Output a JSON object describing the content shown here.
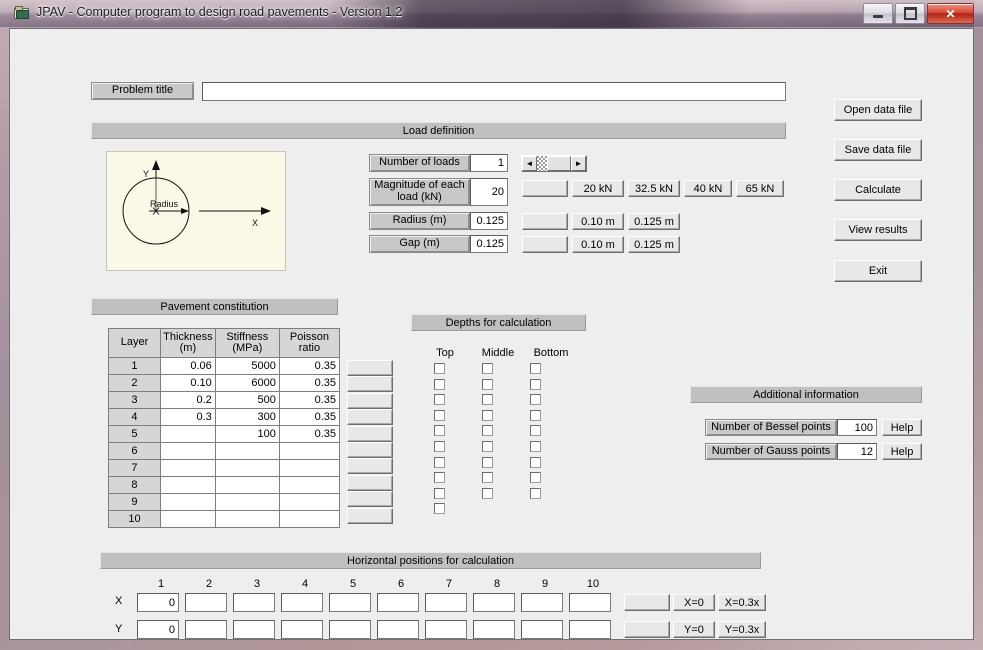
{
  "window": {
    "title": "JPAV - Computer program to design road pavements - Version 1.2",
    "icon": "folder-icon",
    "minimize_label": "—",
    "maximize_label": "□",
    "close_label": "✕"
  },
  "problem": {
    "label": "Problem title",
    "value": "",
    "placeholder": ""
  },
  "load_definition": {
    "section_title": "Load definition",
    "diagram": {
      "y_axis_label": "Y",
      "x_axis_label": "X",
      "radius_label": "Radius",
      "center_marker": "x",
      "bg_color": "#fbf8e8"
    },
    "fields": [
      {
        "label": "Number of loads",
        "value": "1"
      },
      {
        "label": "Magnitude of each load (kN)",
        "value": "20"
      },
      {
        "label": "Radius (m)",
        "value": "0.125"
      },
      {
        "label": "Gap (m)",
        "value": "0.125"
      }
    ],
    "spinner": {
      "left_arrow": "◄",
      "right_arrow": "►"
    },
    "magnitude_presets": [
      "",
      "20 kN",
      "32.5 kN",
      "40 kN",
      "65 kN"
    ],
    "radius_presets": [
      "",
      "0.10 m",
      "0.125 m"
    ],
    "gap_presets": [
      "",
      "0.10 m",
      "0.125 m"
    ]
  },
  "actions": {
    "open": "Open data file",
    "save": "Save data file",
    "calculate": "Calculate",
    "view_results": "View results",
    "exit": "Exit"
  },
  "pavement": {
    "section_title": "Pavement constitution",
    "columns": [
      "Layer",
      "Thickness (m)",
      "Stiffness (MPa)",
      "Poisson ratio"
    ],
    "column_lines": [
      [
        "Layer",
        ""
      ],
      [
        "Thickness",
        "(m)"
      ],
      [
        "Stiffness",
        "(MPa)"
      ],
      [
        "Poisson",
        "ratio"
      ]
    ],
    "rows": [
      {
        "layer": "1",
        "thickness": "0.06",
        "stiffness": "5000",
        "poisson": "0.35"
      },
      {
        "layer": "2",
        "thickness": "0.10",
        "stiffness": "6000",
        "poisson": "0.35"
      },
      {
        "layer": "3",
        "thickness": "0.2",
        "stiffness": "500",
        "poisson": "0.35"
      },
      {
        "layer": "4",
        "thickness": "0.3",
        "stiffness": "300",
        "poisson": "0.35"
      },
      {
        "layer": "5",
        "thickness": "",
        "stiffness": "100",
        "poisson": "0.35"
      },
      {
        "layer": "6",
        "thickness": "",
        "stiffness": "",
        "poisson": ""
      },
      {
        "layer": "7",
        "thickness": "",
        "stiffness": "",
        "poisson": ""
      },
      {
        "layer": "8",
        "thickness": "",
        "stiffness": "",
        "poisson": ""
      },
      {
        "layer": "9",
        "thickness": "",
        "stiffness": "",
        "poisson": ""
      },
      {
        "layer": "10",
        "thickness": "",
        "stiffness": "",
        "poisson": ""
      }
    ],
    "row_buttons": [
      "",
      "",
      "",
      "",
      "",
      "",
      "",
      "",
      "",
      ""
    ]
  },
  "depths": {
    "section_title": "Depths for calculation",
    "columns": [
      "Top",
      "Middle",
      "Bottom"
    ],
    "top_count": 10,
    "middle_count": 9,
    "bottom_count": 9,
    "checked": false
  },
  "additional_information": {
    "section_title": "Additional information",
    "rows": [
      {
        "label": "Number of Bessel points",
        "value": "100",
        "help": "Help"
      },
      {
        "label": "Number of Gauss points",
        "value": "12",
        "help": "Help"
      }
    ]
  },
  "horizontal_positions": {
    "section_title": "Horizontal positions for calculation",
    "column_numbers": [
      "1",
      "2",
      "3",
      "4",
      "5",
      "6",
      "7",
      "8",
      "9",
      "10"
    ],
    "rows": [
      {
        "axis": "X",
        "values": [
          "0",
          "",
          "",
          "",
          "",
          "",
          "",
          "",
          "",
          ""
        ],
        "buttons": [
          "",
          "X=0",
          "X=0.3x"
        ]
      },
      {
        "axis": "Y",
        "values": [
          "0",
          "",
          "",
          "",
          "",
          "",
          "",
          "",
          "",
          ""
        ],
        "buttons": [
          "",
          "Y=0",
          "Y=0.3x"
        ]
      }
    ]
  },
  "colors": {
    "client_bg": "#eeeeee",
    "section_bar": "#c0c0c0",
    "label_bg": "#c8c8c8",
    "field_bg": "#ffffff",
    "diagram_bg": "#fbf8e8",
    "close_button": "#d84a34"
  }
}
